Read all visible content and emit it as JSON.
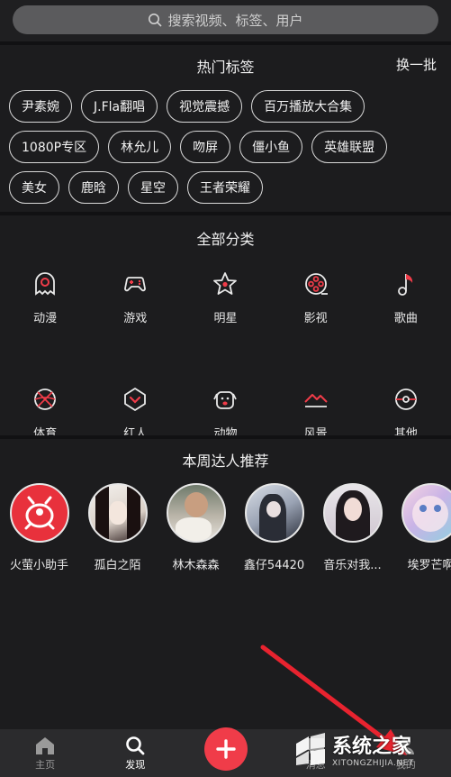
{
  "search": {
    "placeholder": "搜索视频、标签、用户"
  },
  "hot_tags": {
    "title": "热门标签",
    "refresh_label": "换一批",
    "rows": [
      [
        "尹素婉",
        "J.Fla翻唱",
        "视觉震撼",
        "百万播放大合集"
      ],
      [
        "1080P专区",
        "林允儿",
        "吻屏",
        "僵小鱼",
        "英雄联盟"
      ],
      [
        "美女",
        "鹿晗",
        "星空",
        "王者荣耀"
      ]
    ]
  },
  "categories": {
    "title": "全部分类",
    "items": [
      {
        "label": "动漫",
        "icon": "ghost-icon"
      },
      {
        "label": "游戏",
        "icon": "gamepad-icon"
      },
      {
        "label": "明星",
        "icon": "star-icon"
      },
      {
        "label": "影视",
        "icon": "film-reel-icon"
      },
      {
        "label": "歌曲",
        "icon": "music-note-icon"
      },
      {
        "label": "体育",
        "icon": "basketball-icon"
      },
      {
        "label": "红人",
        "icon": "heart-badge-icon"
      },
      {
        "label": "动物",
        "icon": "dog-face-icon"
      },
      {
        "label": "风景",
        "icon": "mountain-icon"
      },
      {
        "label": "其他",
        "icon": "compass-icon"
      }
    ]
  },
  "weekly_talent": {
    "title": "本周达人推荐",
    "people": [
      {
        "name": "火萤小助手"
      },
      {
        "name": "孤白之陌"
      },
      {
        "name": "林木森森"
      },
      {
        "name": "鑫仔54420"
      },
      {
        "name": "音乐对我..."
      },
      {
        "name": "埃罗芒啊"
      }
    ]
  },
  "tabbar": {
    "home": "主页",
    "discover": "发现",
    "message": "消息",
    "me": "我的"
  },
  "watermark": {
    "main": "系统之家",
    "sub": "XITONGZHIJIA.NET"
  },
  "colors": {
    "accent": "#f03c49",
    "background": "#1c1c1e"
  }
}
